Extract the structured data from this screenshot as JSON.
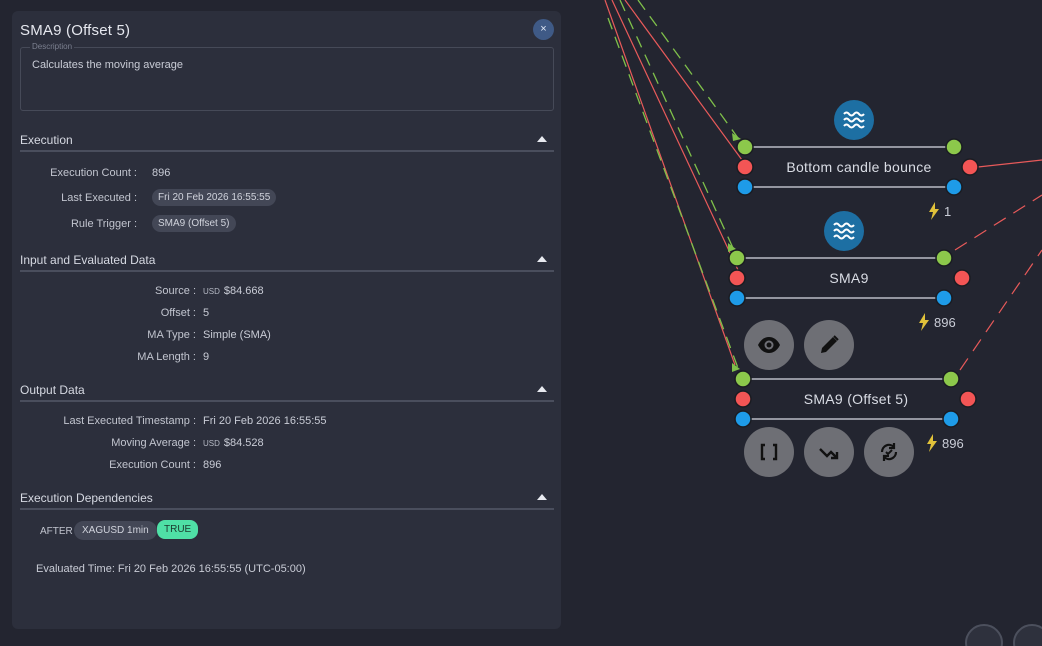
{
  "panel": {
    "title": "SMA9 (Offset 5)",
    "close_label": "×",
    "description_label": "Description",
    "description": "Calculates the moving average"
  },
  "execution": {
    "header": "Execution",
    "rows": [
      {
        "key": "Execution Count :",
        "value": "896"
      },
      {
        "key": "Last Executed :",
        "value": "Fri 20 Feb 2026 16:55:55"
      },
      {
        "key": "Rule Trigger :",
        "value": "SMA9 (Offset 5)"
      }
    ]
  },
  "input": {
    "header": "Input and Evaluated Data",
    "rows": [
      {
        "key": "Source :",
        "currency": "USD",
        "value": "$84.668"
      },
      {
        "key": "Offset :",
        "value": "5"
      },
      {
        "key": "MA Type :",
        "value": "Simple (SMA)"
      },
      {
        "key": "MA Length :",
        "value": "9"
      }
    ]
  },
  "output": {
    "header": "Output Data",
    "rows": [
      {
        "key": "Last Executed Timestamp :",
        "value": "Fri 20 Feb 2026 16:55:55"
      },
      {
        "key": "Moving Average :",
        "currency": "USD",
        "value": "$84.528"
      },
      {
        "key": "Execution Count :",
        "value": "896"
      }
    ]
  },
  "dependencies": {
    "header": "Execution Dependencies",
    "after_label": "AFTER",
    "dependency": "XAGUSD 1min",
    "status": "TRUE",
    "evaluated_time": "Evaluated Time: Fri 20 Feb 2026 16:55:55 (UTC-05:00)"
  },
  "graph": {
    "nodes": [
      {
        "label": "Bottom candle bounce",
        "count": "1",
        "icon": "waves-icon"
      },
      {
        "label": "SMA9",
        "count": "896",
        "icon": "waves-icon"
      },
      {
        "label": "SMA9 (Offset 5)",
        "count": "896"
      }
    ],
    "colors": {
      "input": "#8cc84b",
      "output": "#f35555",
      "aux": "#1e9be8",
      "icon_bg": "#1d6fa3",
      "edge_red": "#e85a5a",
      "edge_green": "#7fc04a"
    }
  }
}
